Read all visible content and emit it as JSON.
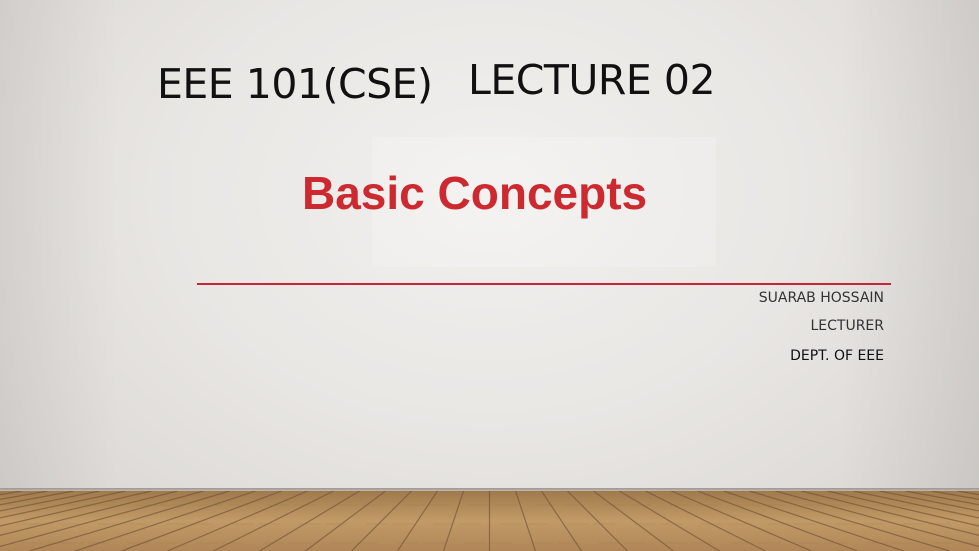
{
  "slide": {
    "title_course": "EEE 101(CSE)",
    "title_lecture": "LECTURE 02",
    "subtitle": "Basic Concepts",
    "author": {
      "name": "SUARAB HOSSAIN",
      "role": "LECTURER",
      "dept": "DEPT. OF EEE"
    }
  },
  "colors": {
    "subtitle": "#cc2a30",
    "rule": "#c8243a",
    "floor_base": "#b58e5e"
  }
}
